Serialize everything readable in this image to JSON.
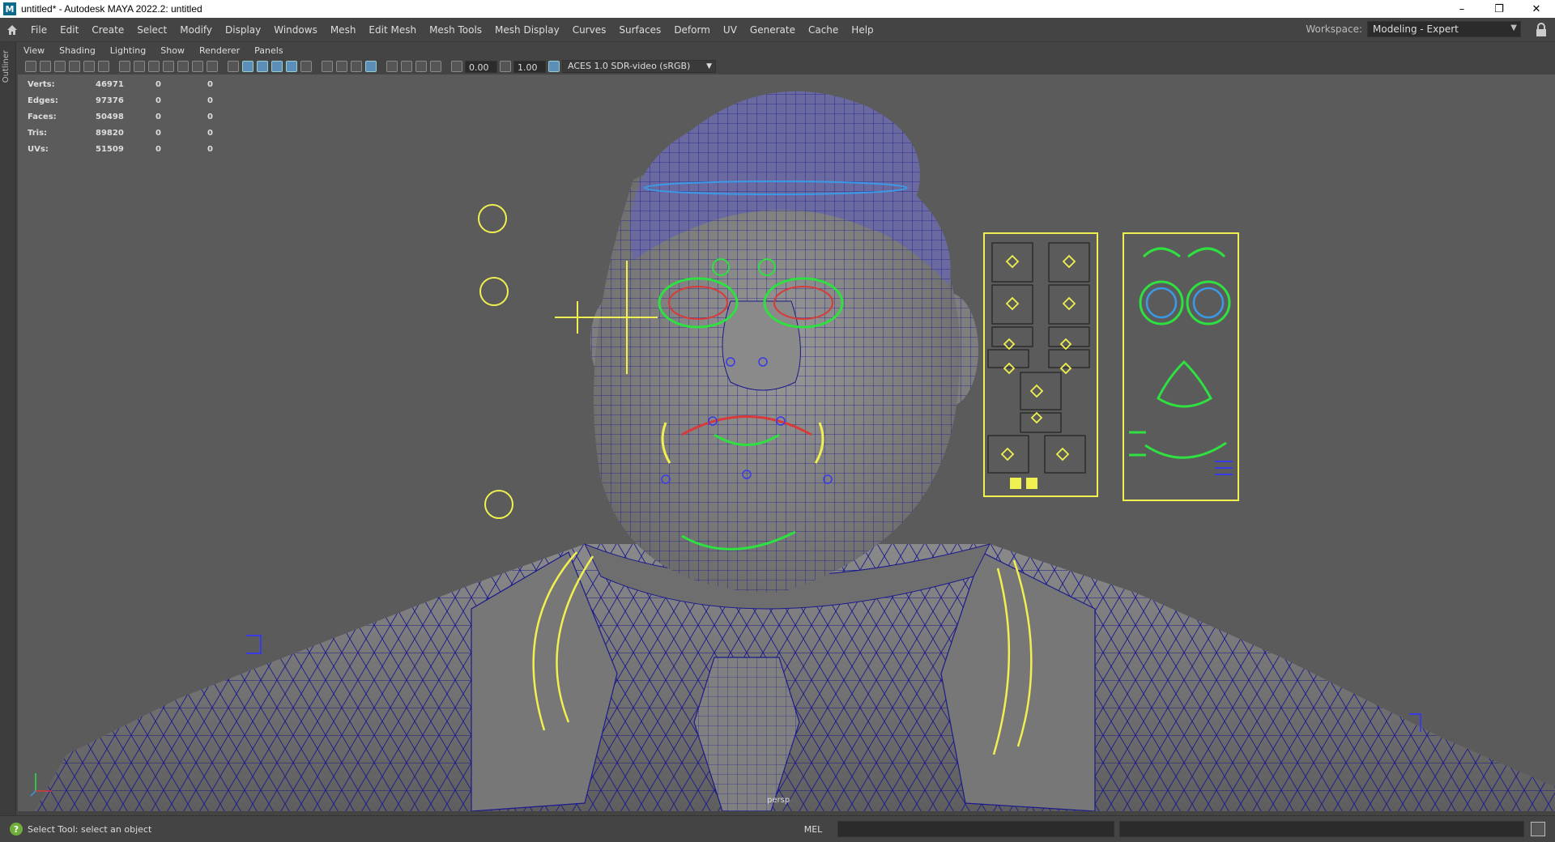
{
  "window": {
    "title": "untitled* - Autodesk MAYA 2022.2: untitled",
    "app_icon": "M",
    "minimize": "–",
    "maximize": "❐",
    "close": "✕"
  },
  "menubar": {
    "items": [
      "File",
      "Edit",
      "Create",
      "Select",
      "Modify",
      "Display",
      "Windows",
      "Mesh",
      "Edit Mesh",
      "Mesh Tools",
      "Mesh Display",
      "Curves",
      "Surfaces",
      "Deform",
      "UV",
      "Generate",
      "Cache",
      "Help"
    ],
    "workspace_label": "Workspace:",
    "workspace_value": "Modeling - Expert"
  },
  "left_strip": {
    "tab": "Outliner"
  },
  "panel_menu": {
    "items": [
      "View",
      "Shading",
      "Lighting",
      "Show",
      "Renderer",
      "Panels"
    ]
  },
  "panel_toolbar": {
    "field_a": "0.00",
    "field_b": "1.00",
    "color_space": "ACES 1.0 SDR-video (sRGB)"
  },
  "hud": {
    "rows": [
      {
        "label": "Verts:",
        "v1": "46971",
        "v2": "0",
        "v3": "0"
      },
      {
        "label": "Edges:",
        "v1": "97376",
        "v2": "0",
        "v3": "0"
      },
      {
        "label": "Faces:",
        "v1": "50498",
        "v2": "0",
        "v3": "0"
      },
      {
        "label": "Tris:",
        "v1": "89820",
        "v2": "0",
        "v3": "0"
      },
      {
        "label": "UVs:",
        "v1": "51509",
        "v2": "0",
        "v3": "0"
      }
    ]
  },
  "viewport": {
    "camera": "persp"
  },
  "status": {
    "help_text": "Select Tool: select an object",
    "command_type": "MEL"
  },
  "colors": {
    "wire": "#1a1a8c",
    "control_yellow": "#f0f050",
    "control_green": "#2ee040",
    "control_blue": "#3a9ae8",
    "control_red": "#d83a3a"
  }
}
